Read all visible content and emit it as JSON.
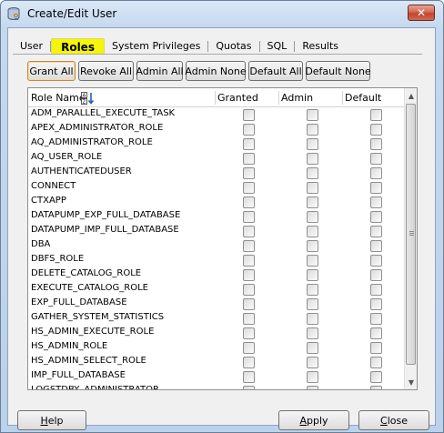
{
  "window": {
    "title": "Create/Edit User",
    "close_glyph": "✕"
  },
  "tabs": [
    {
      "label": "User",
      "active": false
    },
    {
      "label": "Roles",
      "active": true
    },
    {
      "label": "System Privileges",
      "active": false
    },
    {
      "label": "Quotas",
      "active": false
    },
    {
      "label": "SQL",
      "active": false
    },
    {
      "label": "Results",
      "active": false
    }
  ],
  "toolbar": {
    "grant_all": "Grant All",
    "revoke_all": "Revoke All",
    "admin_all": "Admin All",
    "admin_none": "Admin None",
    "default_all": "Default All",
    "default_none": "Default None"
  },
  "table": {
    "headers": {
      "role_name": "Role Name",
      "granted": "Granted",
      "admin": "Admin",
      "default": "Default"
    },
    "rows": [
      {
        "name": "ADM_PARALLEL_EXECUTE_TASK",
        "granted": false,
        "admin": false,
        "default": false
      },
      {
        "name": "APEX_ADMINISTRATOR_ROLE",
        "granted": false,
        "admin": false,
        "default": false
      },
      {
        "name": "AQ_ADMINISTRATOR_ROLE",
        "granted": false,
        "admin": false,
        "default": false
      },
      {
        "name": "AQ_USER_ROLE",
        "granted": false,
        "admin": false,
        "default": false
      },
      {
        "name": "AUTHENTICATEDUSER",
        "granted": false,
        "admin": false,
        "default": false
      },
      {
        "name": "CONNECT",
        "granted": false,
        "admin": false,
        "default": false
      },
      {
        "name": "CTXAPP",
        "granted": false,
        "admin": false,
        "default": false
      },
      {
        "name": "DATAPUMP_EXP_FULL_DATABASE",
        "granted": false,
        "admin": false,
        "default": false
      },
      {
        "name": "DATAPUMP_IMP_FULL_DATABASE",
        "granted": false,
        "admin": false,
        "default": false
      },
      {
        "name": "DBA",
        "granted": false,
        "admin": false,
        "default": false
      },
      {
        "name": "DBFS_ROLE",
        "granted": false,
        "admin": false,
        "default": false
      },
      {
        "name": "DELETE_CATALOG_ROLE",
        "granted": false,
        "admin": false,
        "default": false
      },
      {
        "name": "EXECUTE_CATALOG_ROLE",
        "granted": false,
        "admin": false,
        "default": false
      },
      {
        "name": "EXP_FULL_DATABASE",
        "granted": false,
        "admin": false,
        "default": false
      },
      {
        "name": "GATHER_SYSTEM_STATISTICS",
        "granted": false,
        "admin": false,
        "default": false
      },
      {
        "name": "HS_ADMIN_EXECUTE_ROLE",
        "granted": false,
        "admin": false,
        "default": false
      },
      {
        "name": "HS_ADMIN_ROLE",
        "granted": false,
        "admin": false,
        "default": false
      },
      {
        "name": "HS_ADMIN_SELECT_ROLE",
        "granted": false,
        "admin": false,
        "default": false
      },
      {
        "name": "IMP_FULL_DATABASE",
        "granted": false,
        "admin": false,
        "default": false
      },
      {
        "name": "LOGSTDBY_ADMINISTRATOR",
        "granted": false,
        "admin": false,
        "default": false
      }
    ]
  },
  "footer": {
    "help_label": "Help",
    "help_mnemonic": "H",
    "help_rest": "elp",
    "apply_label": "Apply",
    "apply_mnemonic": "A",
    "apply_rest": "pply",
    "close_label": "Close",
    "close_mnemonic": "C",
    "close_rest": "lose"
  },
  "colors": {
    "active_tab_highlight": "#f5f50a",
    "close_button": "#c4442c"
  }
}
